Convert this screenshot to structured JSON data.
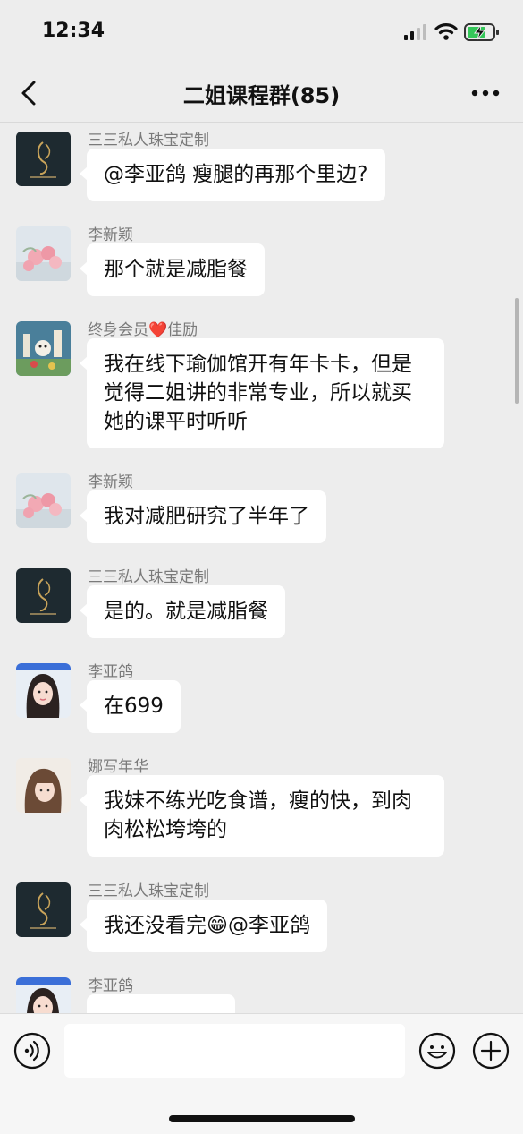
{
  "status_bar": {
    "time": "12:34"
  },
  "nav": {
    "title": "二姐课程群(85)"
  },
  "messages": [
    {
      "sender": "三三私人珠宝定制",
      "avatar": "jewelry-logo-avatar",
      "text": "@李亚鸽 瘦腿的再那个里边?"
    },
    {
      "sender": "李新颖",
      "avatar": "roses-avatar",
      "text": "那个就是减脂餐"
    },
    {
      "sender_prefix": "终身会员",
      "sender_suffix": "佳励",
      "sender_heart": "❤️",
      "avatar": "cartoon-avatar",
      "text": "我在线下瑜伽馆开有年卡卡，但是觉得二姐讲的非常专业，所以就买她的课平时听听"
    },
    {
      "sender": "李新颖",
      "avatar": "roses-avatar",
      "text": "我对减肥研究了半年了"
    },
    {
      "sender": "三三私人珠宝定制",
      "avatar": "jewelry-logo-avatar",
      "text": "是的。就是减脂餐"
    },
    {
      "sender": "李亚鸽",
      "avatar": "girl-photo-avatar",
      "text": "在699"
    },
    {
      "sender": "娜写年华",
      "avatar": "woman-photo-avatar",
      "text": "我妹不练光吃食谱，瘦的快，到肉肉松松垮垮的"
    },
    {
      "sender": "三三私人珠宝定制",
      "avatar": "jewelry-logo-avatar",
      "text_before": "我还没看完",
      "emoji": "😁",
      "text_after": "@李亚鸽"
    },
    {
      "sender": "李亚鸽",
      "avatar": "girl-photo-avatar",
      "text": ""
    }
  ],
  "icons": {
    "back": "chevron-left-icon",
    "more": "more-dots-icon",
    "voice": "voice-icon",
    "emoji": "emoji-icon",
    "plus": "plus-icon"
  },
  "colors": {
    "background": "#ededed",
    "bubble": "#ffffff",
    "sender_text": "#7a7a7a"
  }
}
